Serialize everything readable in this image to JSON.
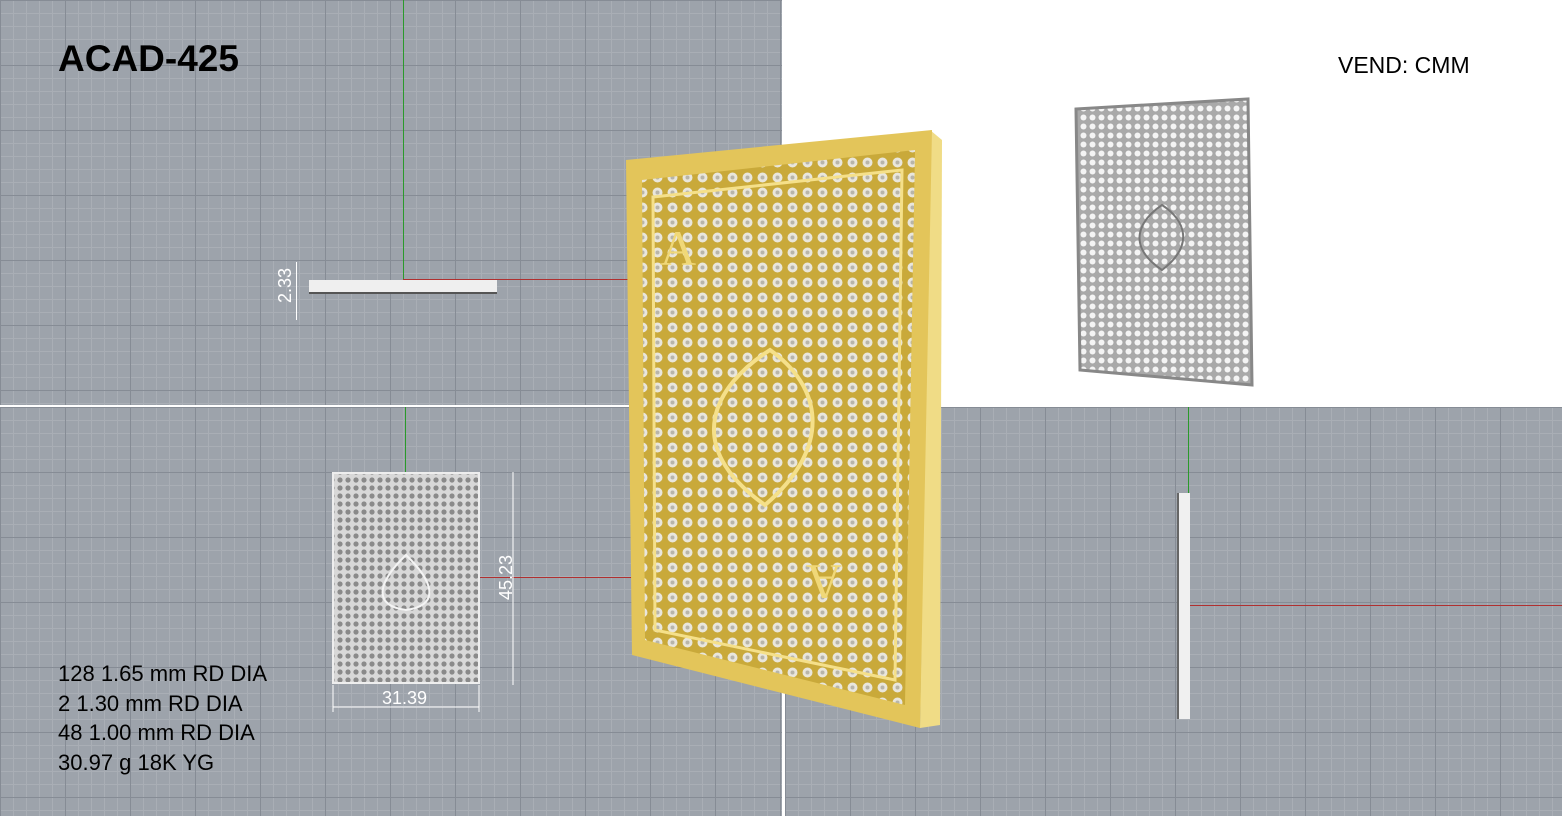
{
  "header": {
    "title": "ACAD-425",
    "vendor": "VEND: CMM"
  },
  "dimensions": {
    "thickness": "2.33",
    "height": "45.23",
    "width": "31.39"
  },
  "specs": [
    "128 1.65 mm RD DIA",
    "2 1.30 mm RD DIA",
    "48 1.00 mm RD DIA",
    "30.97 g 18K YG"
  ],
  "colors": {
    "grid": "#9da3ab",
    "gold": "#e8cf6a",
    "axis_x": "#b03030",
    "axis_y": "#2a9a2a"
  }
}
